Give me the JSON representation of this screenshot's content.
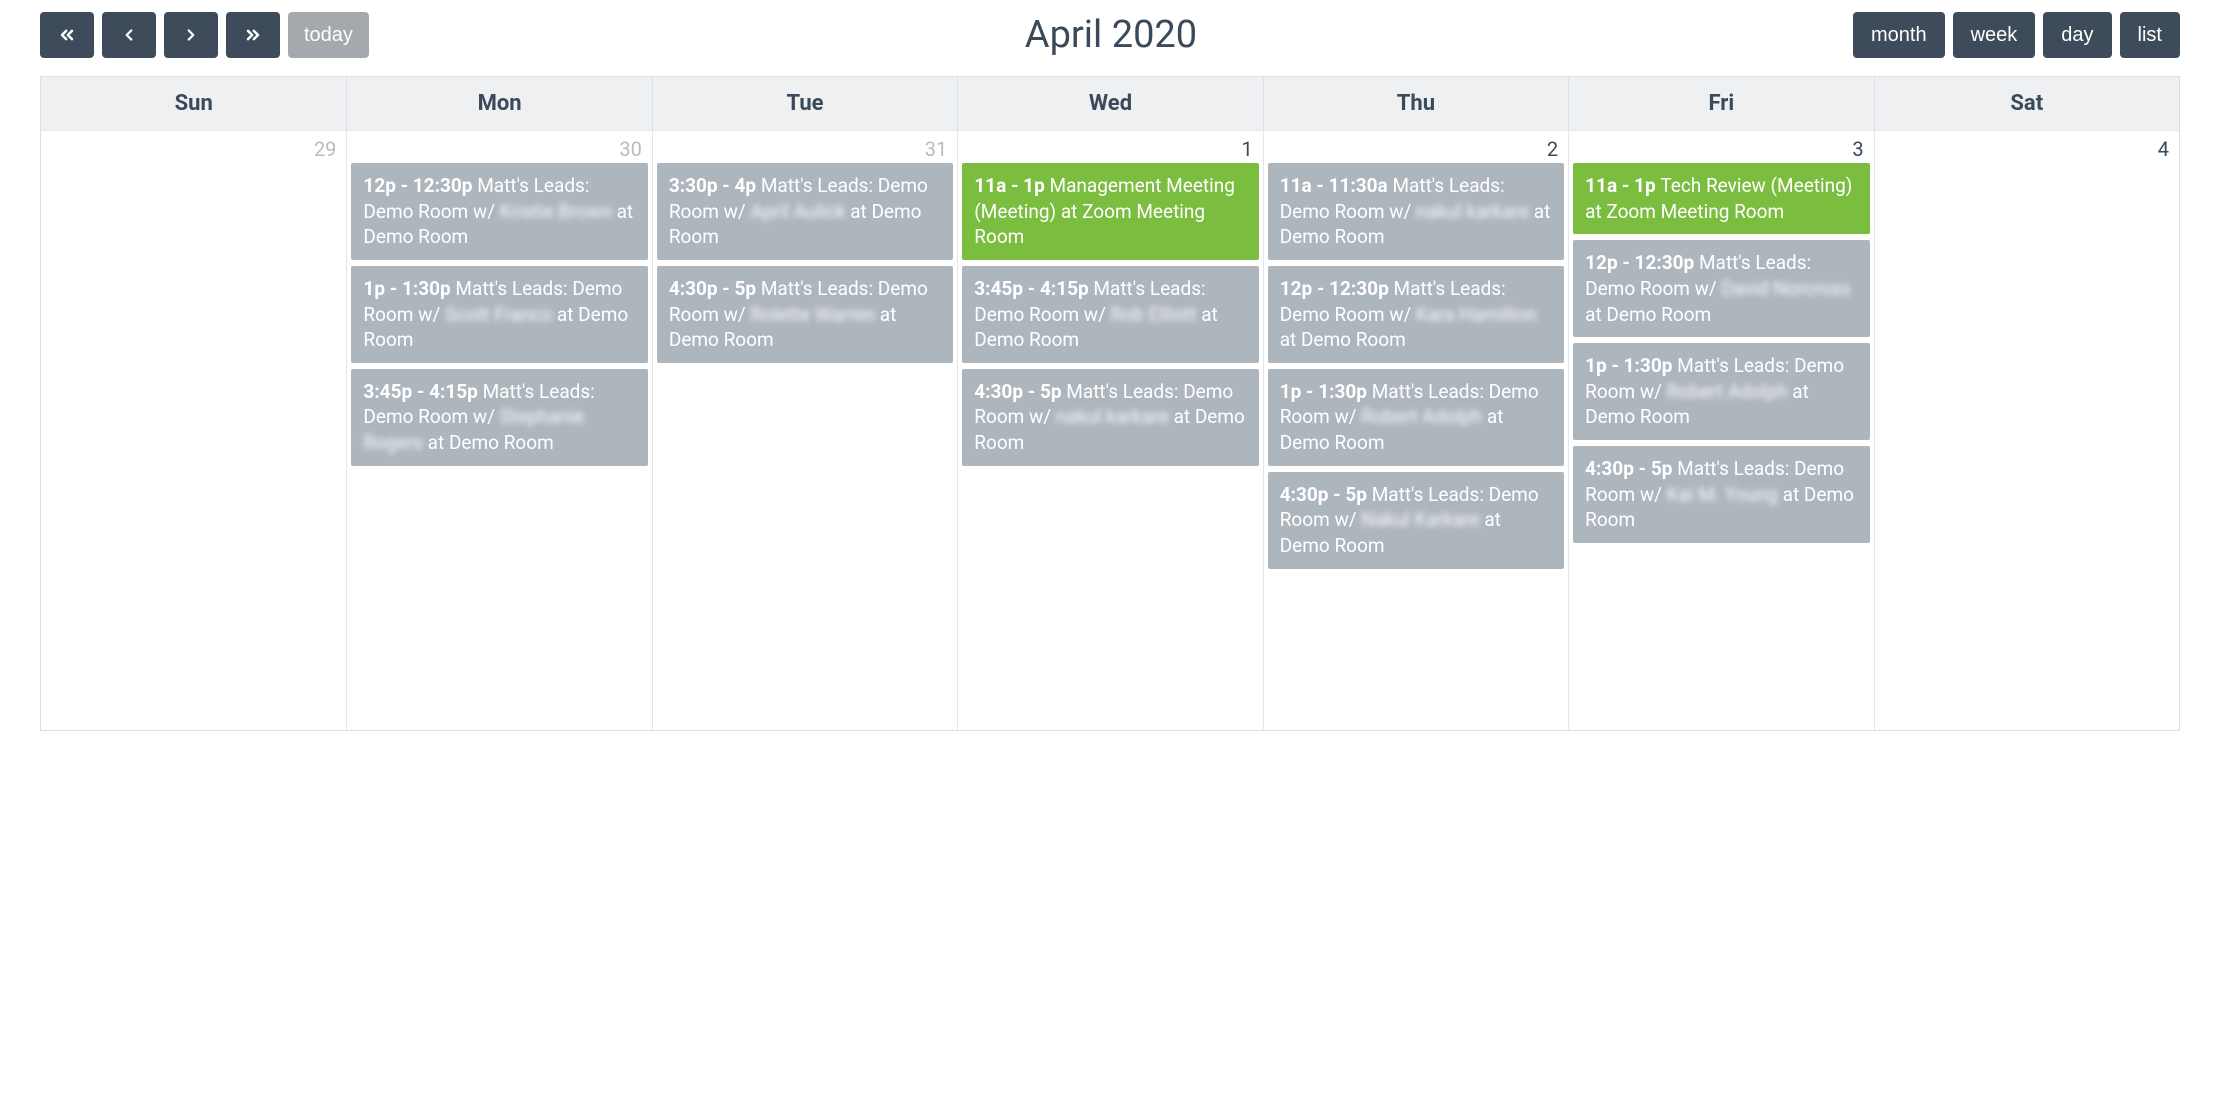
{
  "toolbar": {
    "today_label": "today",
    "views": {
      "month": "month",
      "week": "week",
      "day": "day",
      "list": "list"
    }
  },
  "title": "April 2020",
  "day_headers": [
    "Sun",
    "Mon",
    "Tue",
    "Wed",
    "Thu",
    "Fri",
    "Sat"
  ],
  "days": [
    {
      "num": "29",
      "other": true,
      "events": []
    },
    {
      "num": "30",
      "other": true,
      "events": [
        {
          "color": "gray",
          "time": "12p - 12:30p",
          "title_before": "Matt's Leads: Demo Room w/ ",
          "blur": "Kristie Brown",
          "title_after": " at Demo Room"
        },
        {
          "color": "gray",
          "time": "1p - 1:30p",
          "title_before": "Matt's Leads: Demo Room w/ ",
          "blur": "Scott Franco",
          "title_after": " at Demo Room"
        },
        {
          "color": "gray",
          "time": "3:45p - 4:15p",
          "title_before": "Matt's Leads: Demo Room w/ ",
          "blur": "Stephanie Rogers",
          "title_after": " at Demo Room"
        }
      ]
    },
    {
      "num": "31",
      "other": true,
      "events": [
        {
          "color": "gray",
          "time": "3:30p - 4p",
          "title_before": "Matt's Leads: Demo Room w/ ",
          "blur": "April Aulick",
          "title_after": " at Demo Room"
        },
        {
          "color": "gray",
          "time": "4:30p - 5p",
          "title_before": "Matt's Leads: Demo Room w/ ",
          "blur": "Rolette Warren",
          "title_after": " at Demo Room"
        }
      ]
    },
    {
      "num": "1",
      "other": false,
      "events": [
        {
          "color": "green",
          "time": "11a - 1p",
          "title_before": "Management Meeting (Meeting) at Zoom Meeting Room",
          "blur": "",
          "title_after": ""
        },
        {
          "color": "gray",
          "time": "3:45p - 4:15p",
          "title_before": "Matt's Leads: Demo Room w/ ",
          "blur": "Rob Elliott",
          "title_after": " at Demo Room"
        },
        {
          "color": "gray",
          "time": "4:30p - 5p",
          "title_before": "Matt's Leads: Demo Room w/ ",
          "blur": "nakul karkare",
          "title_after": " at Demo Room"
        }
      ]
    },
    {
      "num": "2",
      "other": false,
      "events": [
        {
          "color": "gray",
          "time": "11a - 11:30a",
          "title_before": "Matt's Leads: Demo Room w/ ",
          "blur": "nakul karkare",
          "title_after": " at Demo Room"
        },
        {
          "color": "gray",
          "time": "12p - 12:30p",
          "title_before": "Matt's Leads: Demo Room w/ ",
          "blur": "Kara Hamilton",
          "title_after": " at Demo Room"
        },
        {
          "color": "gray",
          "time": "1p - 1:30p",
          "title_before": "Matt's Leads: Demo Room w/ ",
          "blur": "Robert Adolph",
          "title_after": " at Demo Room"
        },
        {
          "color": "gray",
          "time": "4:30p - 5p",
          "title_before": "Matt's Leads: Demo Room w/ ",
          "blur": "Nakul Karkare",
          "title_after": " at Demo Room"
        }
      ]
    },
    {
      "num": "3",
      "other": false,
      "events": [
        {
          "color": "green",
          "time": "11a - 1p",
          "title_before": "Tech Review (Meeting) at Zoom Meeting Room",
          "blur": "",
          "title_after": ""
        },
        {
          "color": "gray",
          "time": "12p - 12:30p",
          "title_before": "Matt's Leads: Demo Room w/ ",
          "blur": "David Norcross",
          "title_after": " at Demo Room"
        },
        {
          "color": "gray",
          "time": "1p - 1:30p",
          "title_before": "Matt's Leads: Demo Room w/ ",
          "blur": "Robert Adolph",
          "title_after": " at Demo Room"
        },
        {
          "color": "gray",
          "time": "4:30p - 5p",
          "title_before": "Matt's Leads: Demo Room w/ ",
          "blur": "Kai M. Young",
          "title_after": " at Demo Room"
        }
      ]
    },
    {
      "num": "4",
      "other": false,
      "events": []
    }
  ]
}
